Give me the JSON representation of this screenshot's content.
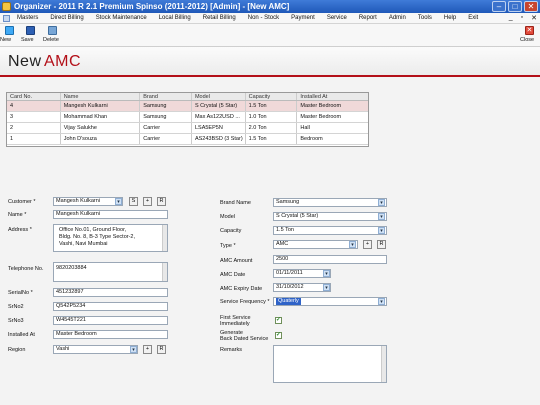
{
  "window": {
    "title": "Organizer - 2011 R 2.1 Premium Spinso (2011-2012) [Admin] - [New AMC]"
  },
  "menu": [
    "Masters",
    "Direct Billing",
    "Stock Maintenance",
    "Local Billing",
    "Retail Billing",
    "Non - Stock",
    "Payment",
    "Service",
    "Report",
    "Admin",
    "Tools",
    "Help",
    "Exit"
  ],
  "toolbar": {
    "new": "New",
    "save": "Save",
    "delete": "Delete",
    "close": "Close"
  },
  "header": {
    "word1": "New",
    "word2": "AMC"
  },
  "grid": {
    "columns": [
      "Card No.",
      "Name",
      "Brand",
      "Model",
      "Capacity",
      "Installed At"
    ],
    "rows": [
      [
        "4",
        "Mangesh Kulkarni",
        "Samsung",
        "S Crystal (5 Star)",
        "1.5 Ton",
        "Master Bedroom"
      ],
      [
        "3",
        "Mohammad Khan",
        "Samsung",
        "Max As122USD ...",
        "1.0 Ton",
        "Master Bedroom"
      ],
      [
        "2",
        "Vijay Salukhe",
        "Carrier",
        "LSA5EP5N",
        "2.0 Ton",
        "Hall"
      ],
      [
        "1",
        "John D'souza",
        "Carrier",
        "AS243BSD (3 Star)",
        "1.5 Ton",
        "Bedroom"
      ]
    ]
  },
  "form": {
    "customer_label": "Customer *",
    "customer": "Mangesh Kulkarni",
    "name_label": "Name *",
    "name": "Mangesh Kulkarni",
    "address_label": "Address *",
    "address_l1": "Office No.01, Ground Floor,",
    "address_l2": "Bldg. No. 8, B-3 Type Sector-2,",
    "address_l3": "Vashi, Navi Mumbai",
    "telephone_label": "Telephone No.",
    "telephone": "9820203884",
    "serial1_label": "SerialNo *",
    "serial1": "451232897",
    "serial2_label": "SrNo2",
    "serial2": "Q542P5234",
    "serial3_label": "SrNo3",
    "serial3": "W4545T221",
    "installed_label": "Installed At",
    "installed": "Master Bedroom",
    "region_label": "Region",
    "region": "Vashi",
    "brand_label": "Brand Name",
    "brand": "Samsung",
    "model_label": "Model",
    "model": "S Crystal (5 Star)",
    "capacity_label": "Capacity",
    "capacity": "1.5 Ton",
    "type_label": "Type *",
    "type": "AMC",
    "amount_label": "AMC Amount",
    "amount": "2500",
    "date_label": "AMC Date",
    "date": "01/11/2011",
    "expiry_label": "AMC Expiry Date",
    "expiry": "31/10/2012",
    "frequency_label": "Service Frequency *",
    "frequency": "Quaterly",
    "first_service_label_1": "First Service",
    "first_service_label_2": "Immediately",
    "generate_label_1": "Generate",
    "generate_label_2": "Back Dated Service",
    "remarks_label": "Remarks",
    "btn_s": "S",
    "btn_plus": "+",
    "btn_r": "R"
  }
}
